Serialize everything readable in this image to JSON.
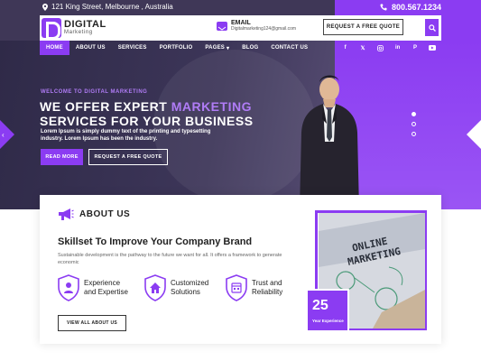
{
  "topbar": {
    "address": "121 King Street, Melbourne , Australia",
    "phone": "800.567.1234"
  },
  "header": {
    "logo_line1": "DIGITAL",
    "logo_line2": "Marketing",
    "email_label": "EMAIL",
    "email_value": "Digitalmarketing124@gmail.com",
    "quote_button": "REQUEST A FREE QUOTE"
  },
  "nav": {
    "items": [
      "HOME",
      "ABOUT US",
      "SERVICES",
      "PORTFOLIO",
      "PAGES",
      "BLOG",
      "CONTACT US"
    ]
  },
  "social_icons": [
    "facebook-icon",
    "x-icon",
    "instagram-icon",
    "linkedin-icon",
    "pinterest-icon",
    "youtube-icon"
  ],
  "hero": {
    "welcome": "WELCOME TO DIGITAL MARKETING",
    "headline_pre": "WE OFFER EXPERT ",
    "headline_accent": "MARKETING",
    "headline_line2": "SERVICES FOR YOUR BUSINESS",
    "description": "Lorem Ipsum is simply dummy text of the printing and typesetting industry. Lorem  Ipsum has been the industry.",
    "read_more": "READ MORE",
    "quote_button": "REQUEST A FREE QUOTE"
  },
  "about": {
    "title": "ABOUT US",
    "heading": "Skillset To Improve Your Company Brand",
    "paragraph": "Sustainable development is the pathway to the future we want for all. It offers a framework to generate economic",
    "features": [
      {
        "line1": "Experience",
        "line2": "and Expertise",
        "icon": "user-shield-icon"
      },
      {
        "line1": "Customized",
        "line2": "Solutions",
        "icon": "home-shield-icon"
      },
      {
        "line1": "Trust and",
        "line2": "Reliability",
        "icon": "calendar-shield-icon"
      }
    ],
    "view_button": "VIEW ALL ABOUT US",
    "experience_number": "25",
    "experience_label": "Year Experience"
  },
  "colors": {
    "accent": "#8b3cf2",
    "dark": "#3f3757"
  }
}
